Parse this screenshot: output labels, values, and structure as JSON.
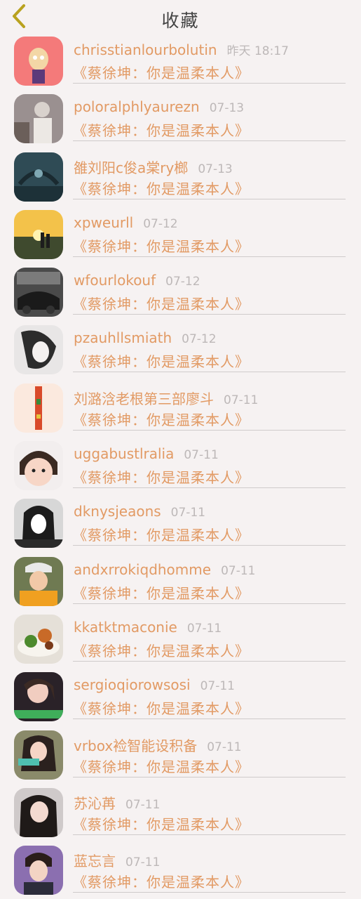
{
  "header": {
    "title": "收藏",
    "back_icon": "chevron-left-icon"
  },
  "colors": {
    "accent": "#e29a64",
    "back": "#b9a21f",
    "time": "#bdb8b8"
  },
  "items": [
    {
      "name": "chrisstianlourbolutin",
      "time": "昨天 18:17",
      "message": "《蔡徐坤：你是温柔本人》"
    },
    {
      "name": "poloralphlyaurezn",
      "time": "07-13",
      "message": "《蔡徐坤：你是温柔本人》"
    },
    {
      "name": "雒刘阳c俊a棠ry榔",
      "time": "07-13",
      "message": "《蔡徐坤：你是温柔本人》"
    },
    {
      "name": "xpweurll",
      "time": "07-12",
      "message": "《蔡徐坤：你是温柔本人》"
    },
    {
      "name": "wfourlokouf",
      "time": "07-12",
      "message": "《蔡徐坤：你是温柔本人》"
    },
    {
      "name": "pzauhllsmiath",
      "time": "07-12",
      "message": "《蔡徐坤：你是温柔本人》"
    },
    {
      "name": "刘潞浛老根第三部廖斗",
      "time": "07-11",
      "message": "《蔡徐坤：你是温柔本人》"
    },
    {
      "name": "uggabustlralia",
      "time": "07-11",
      "message": "《蔡徐坤：你是温柔本人》"
    },
    {
      "name": "dknysjeaons",
      "time": "07-11",
      "message": "《蔡徐坤：你是温柔本人》"
    },
    {
      "name": "andxrrokiqdhomme",
      "time": "07-11",
      "message": "《蔡徐坤：你是温柔本人》"
    },
    {
      "name": "kkatktmaconie",
      "time": "07-11",
      "message": "《蔡徐坤：你是温柔本人》"
    },
    {
      "name": "sergioqiorowsosi",
      "time": "07-11",
      "message": "《蔡徐坤：你是温柔本人》"
    },
    {
      "name": "vrbox裣智能设积备",
      "time": "07-11",
      "message": "《蔡徐坤：你是温柔本人》"
    },
    {
      "name": "苏沁苒",
      "time": "07-11",
      "message": "《蔡徐坤：你是温柔本人》"
    },
    {
      "name": "蓝忘言",
      "time": "07-11",
      "message": "《蔡徐坤：你是温柔本人》"
    }
  ]
}
